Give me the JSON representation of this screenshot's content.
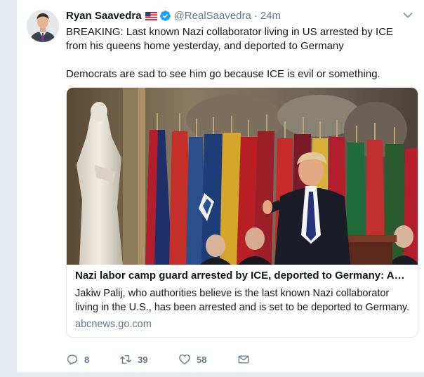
{
  "tweet": {
    "display_name": "Ryan Saavedra",
    "handle": "@RealSaavedra",
    "separator": "·",
    "time": "24m",
    "text_lines": [
      "BREAKING: Last known Nazi collaborator living in US arrested by ICE from his queens home yesterday, and deported to Germany",
      "Democrats are sad to see him go because ICE is evil or something."
    ],
    "flag_icon": "us-flag-icon",
    "verified_icon": "verified-badge-icon"
  },
  "card": {
    "title": "Nazi labor camp guard arrested by ICE, deported to Germany: Authorities",
    "description": "Jakiw Palij, who authorities believe is the last known Nazi collaborator living in the U.S., has been arrested and is set to be deported to Germany.",
    "domain": "abcnews.go.com"
  },
  "actions": {
    "reply_count": "8",
    "retweet_count": "39",
    "like_count": "58"
  },
  "colors": {
    "secondary_text": "#657786",
    "verified_blue": "#1da1f2",
    "background": "#e6ecf0"
  }
}
